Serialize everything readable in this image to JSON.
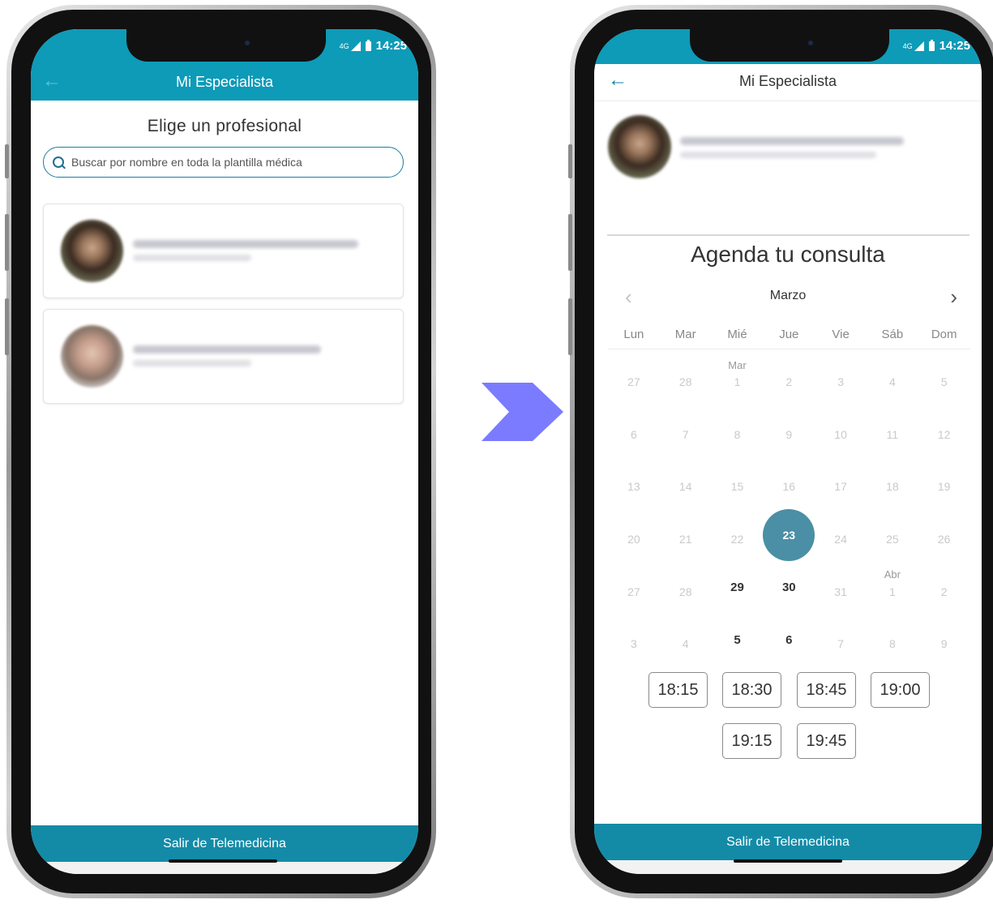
{
  "status": {
    "time": "14:25",
    "network": "4G"
  },
  "screen1": {
    "appbar_title": "Mi Especialista",
    "heading": "Elige un profesional",
    "search_placeholder": "Buscar por nombre en toda la plantilla médica",
    "exit_button": "Salir de Telemedicina"
  },
  "screen2": {
    "appbar_title": "Mi Especialista",
    "agenda_title": "Agenda tu consulta",
    "month": "Marzo",
    "weekdays": [
      "Lun",
      "Mar",
      "Mié",
      "Jue",
      "Vie",
      "Sáb",
      "Dom"
    ],
    "calendar": [
      [
        {
          "d": "27"
        },
        {
          "d": "28"
        },
        {
          "d": "1",
          "m": "Mar"
        },
        {
          "d": "2"
        },
        {
          "d": "3"
        },
        {
          "d": "4"
        },
        {
          "d": "5"
        }
      ],
      [
        {
          "d": "6"
        },
        {
          "d": "7"
        },
        {
          "d": "8"
        },
        {
          "d": "9"
        },
        {
          "d": "10"
        },
        {
          "d": "11"
        },
        {
          "d": "12"
        }
      ],
      [
        {
          "d": "13"
        },
        {
          "d": "14"
        },
        {
          "d": "15"
        },
        {
          "d": "16"
        },
        {
          "d": "17"
        },
        {
          "d": "18"
        },
        {
          "d": "19"
        }
      ],
      [
        {
          "d": "20"
        },
        {
          "d": "21"
        },
        {
          "d": "22"
        },
        {
          "d": "23",
          "state": "selected"
        },
        {
          "d": "24"
        },
        {
          "d": "25"
        },
        {
          "d": "26"
        }
      ],
      [
        {
          "d": "27"
        },
        {
          "d": "28"
        },
        {
          "d": "29",
          "state": "available"
        },
        {
          "d": "30",
          "state": "available"
        },
        {
          "d": "31"
        },
        {
          "d": "1",
          "m": "Abr"
        },
        {
          "d": "2"
        }
      ],
      [
        {
          "d": "3"
        },
        {
          "d": "4"
        },
        {
          "d": "5",
          "state": "available"
        },
        {
          "d": "6",
          "state": "available"
        },
        {
          "d": "7"
        },
        {
          "d": "8"
        },
        {
          "d": "9"
        }
      ]
    ],
    "time_slots": [
      "18:15",
      "18:30",
      "18:45",
      "19:00",
      "19:15",
      "19:45"
    ],
    "exit_button": "Salir de Telemedicina"
  },
  "colors": {
    "primary": "#0d9bb8",
    "bottom_bar": "#138ba7",
    "selected_day": "#4a8fa5",
    "arrow": "#7b7bff"
  }
}
